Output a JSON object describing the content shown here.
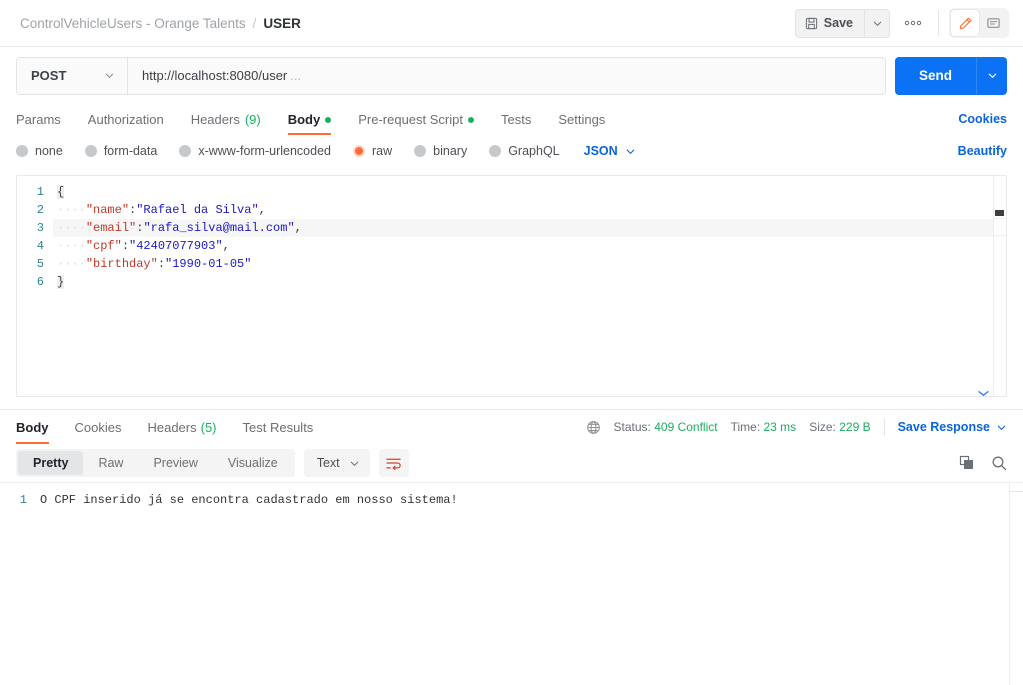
{
  "header": {
    "breadcrumb_collection": "ControlVehicleUsers - Orange Talents",
    "breadcrumb_separator": "/",
    "breadcrumb_current": "USER",
    "save_label": "Save",
    "more_label": "000",
    "save_icon": "floppy-disk-icon",
    "caret_icon": "chevron-down-icon",
    "edit_icon": "pencil-icon",
    "comment_icon": "comment-icon"
  },
  "request": {
    "method": "POST",
    "url": "http://localhost:8080/user",
    "url_ellipsis": "...",
    "send_label": "Send",
    "tabs": [
      {
        "label": "Params",
        "count": "",
        "dot": false,
        "active": false
      },
      {
        "label": "Authorization",
        "count": "",
        "dot": false,
        "active": false
      },
      {
        "label": "Headers",
        "count": "(9)",
        "dot": false,
        "active": false
      },
      {
        "label": "Body",
        "count": "",
        "dot": true,
        "active": true
      },
      {
        "label": "Pre-request Script",
        "count": "",
        "dot": true,
        "active": false
      },
      {
        "label": "Tests",
        "count": "",
        "dot": false,
        "active": false
      },
      {
        "label": "Settings",
        "count": "",
        "dot": false,
        "active": false
      }
    ],
    "cookies_link": "Cookies",
    "beautify_link": "Beautify",
    "body_types": [
      {
        "label": "none",
        "selected": false
      },
      {
        "label": "form-data",
        "selected": false
      },
      {
        "label": "x-www-form-urlencoded",
        "selected": false
      },
      {
        "label": "raw",
        "selected": true
      },
      {
        "label": "binary",
        "selected": false
      },
      {
        "label": "GraphQL",
        "selected": false
      }
    ],
    "format": "JSON",
    "body_lines": [
      {
        "num": "1",
        "indent": "",
        "key": "",
        "value": "",
        "brace": "{",
        "comma": "",
        "highlight": false
      },
      {
        "num": "2",
        "indent": "····",
        "key": "\"name\"",
        "value": "\"Rafael da Silva\"",
        "brace": "",
        "comma": ",",
        "highlight": false
      },
      {
        "num": "3",
        "indent": "····",
        "key": "\"email\"",
        "value": "\"rafa_silva@mail.com\"",
        "brace": "",
        "comma": ",",
        "highlight": true
      },
      {
        "num": "4",
        "indent": "····",
        "key": "\"cpf\"",
        "value": "\"42407077903\"",
        "brace": "",
        "comma": ",",
        "highlight": false
      },
      {
        "num": "5",
        "indent": "····",
        "key": "\"birthday\"",
        "value": "\"1990-01-05\"",
        "brace": "",
        "comma": "",
        "highlight": false
      },
      {
        "num": "6",
        "indent": "",
        "key": "",
        "value": "",
        "brace": "}",
        "comma": "",
        "highlight": false
      }
    ]
  },
  "response": {
    "tabs": [
      {
        "label": "Body",
        "count": "",
        "active": true
      },
      {
        "label": "Cookies",
        "count": "",
        "active": false
      },
      {
        "label": "Headers",
        "count": "(5)",
        "active": false
      },
      {
        "label": "Test Results",
        "count": "",
        "active": false
      }
    ],
    "globe_icon": "globe-icon",
    "status_label": "Status:",
    "status_value": "409 Conflict",
    "time_label": "Time:",
    "time_value": "23 ms",
    "size_label": "Size:",
    "size_value": "229 B",
    "save_response_label": "Save Response",
    "view_modes": [
      {
        "label": "Pretty",
        "active": true
      },
      {
        "label": "Raw",
        "active": false
      },
      {
        "label": "Preview",
        "active": false
      },
      {
        "label": "Visualize",
        "active": false
      }
    ],
    "format": "Text",
    "wrap_icon": "word-wrap-icon",
    "copy_icon": "copy-icon",
    "search_icon": "search-icon",
    "body_line_number": "1",
    "body_text": "O CPF inserido já se encontra cadastrado em nosso sistema!"
  },
  "colors": {
    "accent_orange": "#ff6c37",
    "link_blue": "#0a65d8",
    "send_blue": "#0b72f5",
    "status_green": "#1bae5f",
    "json_key_red": "#c0392b",
    "json_string_blue": "#1b18c4",
    "line_number_teal": "#2e8592"
  }
}
